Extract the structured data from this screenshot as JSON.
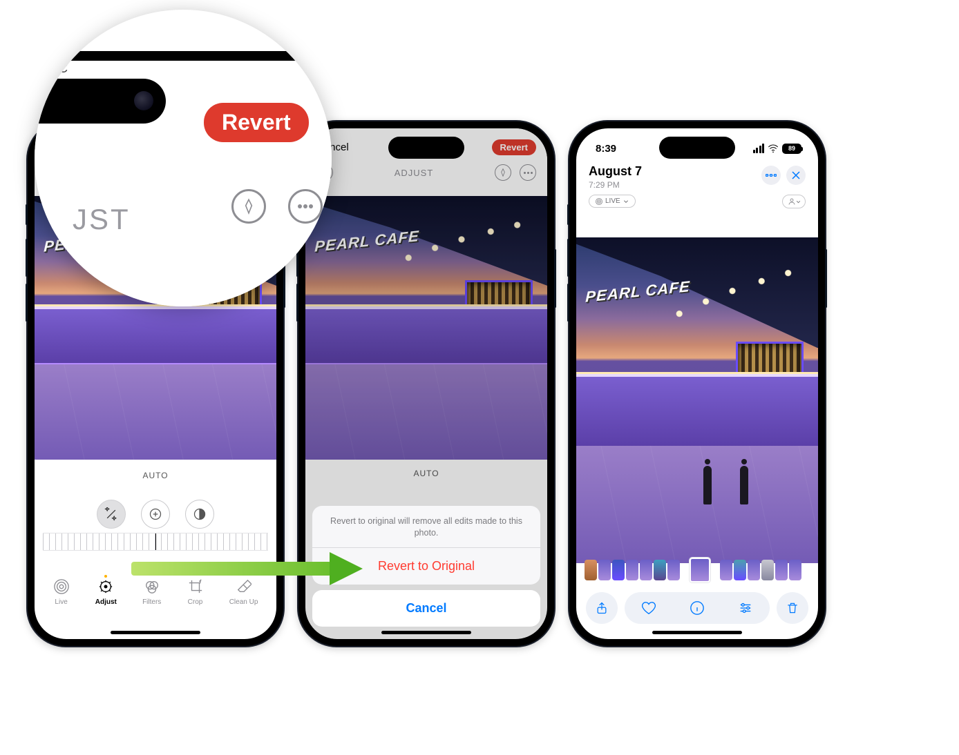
{
  "magnifier": {
    "cancel_fragment": "C",
    "revert_label": "Revert",
    "title_fragment": "JST"
  },
  "phone1": {
    "header": {
      "cancel_label": "Cancel",
      "revert_label": "Revert",
      "tool_title": "ADJUST"
    },
    "photo_sign": "PEARL CAFE",
    "auto_label": "AUTO",
    "tool_icons": [
      "wand-icon",
      "exposure-icon",
      "contrast-icon"
    ],
    "tabs": [
      {
        "icon": "live-circles-icon",
        "label": "Live"
      },
      {
        "icon": "adjust-dial-icon",
        "label": "Adjust"
      },
      {
        "icon": "filters-icon",
        "label": "Filters"
      },
      {
        "icon": "crop-icon",
        "label": "Crop"
      },
      {
        "icon": "eraser-icon",
        "label": "Clean Up"
      }
    ],
    "active_tab_index": 1
  },
  "phone2": {
    "header": {
      "cancel_label": "Cancel",
      "revert_label": "Revert",
      "tool_title": "ADJUST"
    },
    "photo_sign": "PEARL CAFE",
    "auto_label": "AUTO",
    "sheet": {
      "message": "Revert to original will remove all edits made to this photo.",
      "destructive_label": "Revert to Original",
      "cancel_label": "Cancel"
    }
  },
  "phone3": {
    "status": {
      "time": "8:39",
      "battery_label": "89"
    },
    "header": {
      "date": "August 7",
      "time": "7:29 PM",
      "live_label": "LIVE"
    },
    "photo_sign": "PEARL CAFE",
    "toolbar_icons": [
      "share-icon",
      "favorite-icon",
      "info-icon",
      "edit-sliders-icon",
      "trash-icon"
    ]
  }
}
